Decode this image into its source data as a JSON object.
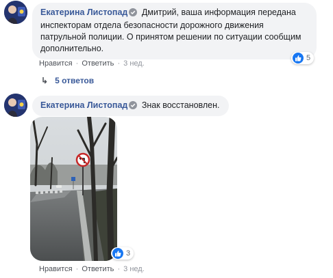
{
  "colors": {
    "link": "#385898",
    "bubble_bg": "#f2f3f5",
    "like_blue": "#1877f2",
    "meta_text": "#90949c"
  },
  "comment1": {
    "author": "Екатерина Листопад",
    "text": "Дмитрий, ваша информация передана инспекторам отдела безопасности дорожного движения патрульной полиции. О принятом решении по ситуации сообщим дополнительно.",
    "reaction_count": "5",
    "reaction_icon": "thumbs-up-icon",
    "like_label": "Нравится",
    "reply_label": "Ответить",
    "time": "3 нед."
  },
  "replies": {
    "arrow": "↳",
    "label": "5 ответов"
  },
  "comment2": {
    "author": "Екатерина Листопад",
    "text": "Знак восстановлен.",
    "reaction_count": "3",
    "reaction_icon": "thumbs-up-icon",
    "like_label": "Нравится",
    "reply_label": "Ответить",
    "time": "3 нед.",
    "photo_description_icon": "road-sign-photo"
  },
  "separator": "·"
}
